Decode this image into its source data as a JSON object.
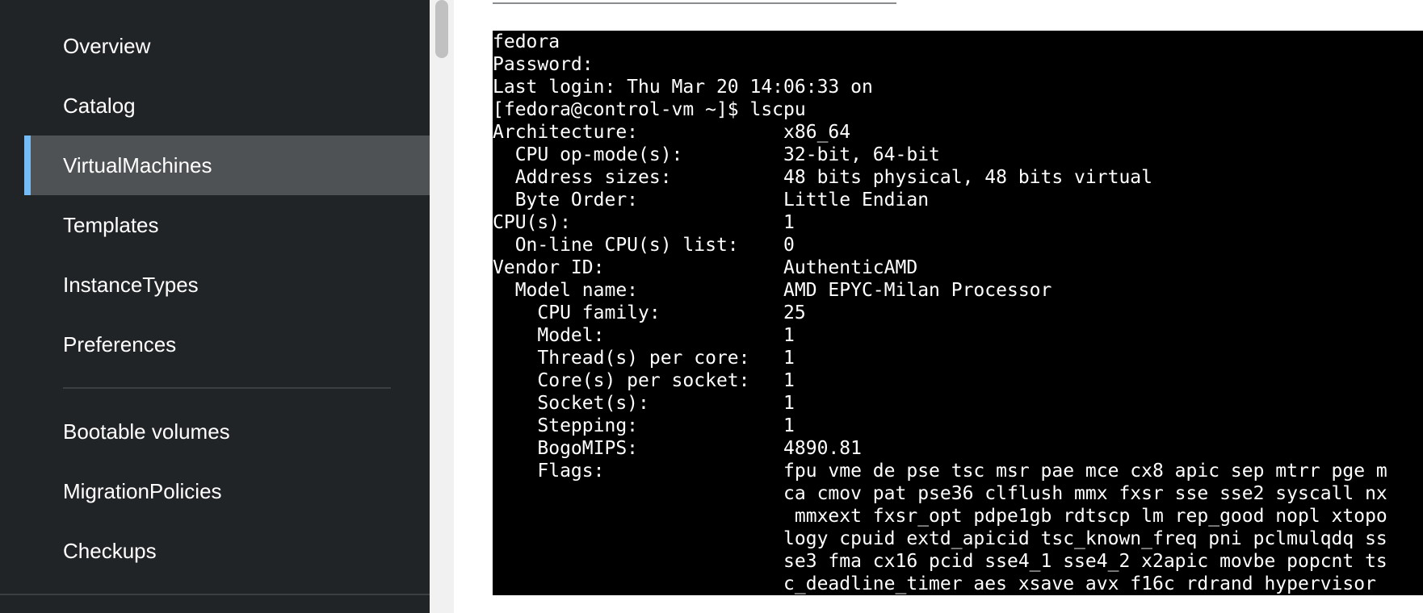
{
  "sidebar": {
    "items": [
      {
        "label": "Overview"
      },
      {
        "label": "Catalog"
      },
      {
        "label": "VirtualMachines",
        "active": true
      },
      {
        "label": "Templates"
      },
      {
        "label": "InstanceTypes"
      },
      {
        "label": "Preferences"
      },
      {
        "label": "Bootable volumes"
      },
      {
        "label": "MigrationPolicies"
      },
      {
        "label": "Checkups"
      }
    ]
  },
  "terminal": {
    "lines": [
      "fedora",
      "Password:",
      "Last login: Thu Mar 20 14:06:33 on",
      "[fedora@control-vm ~]$ lscpu",
      "Architecture:             x86_64",
      "  CPU op-mode(s):         32-bit, 64-bit",
      "  Address sizes:          48 bits physical, 48 bits virtual",
      "  Byte Order:             Little Endian",
      "CPU(s):                   1",
      "  On-line CPU(s) list:    0",
      "Vendor ID:                AuthenticAMD",
      "  Model name:             AMD EPYC-Milan Processor",
      "    CPU family:           25",
      "    Model:                1",
      "    Thread(s) per core:   1",
      "    Core(s) per socket:   1",
      "    Socket(s):            1",
      "    Stepping:             1",
      "    BogoMIPS:             4890.81",
      "    Flags:                fpu vme de pse tsc msr pae mce cx8 apic sep mtrr pge m",
      "                          ca cmov pat pse36 clflush mmx fxsr sse sse2 syscall nx",
      "                           mmxext fxsr_opt pdpe1gb rdtscp lm rep_good nopl xtopo",
      "                          logy cpuid extd_apicid tsc_known_freq pni pclmulqdq ss",
      "                          se3 fma cx16 pcid sse4_1 sse4_2 x2apic movbe popcnt ts",
      "                          c_deadline_timer aes xsave avx f16c rdrand hypervisor"
    ]
  },
  "colors": {
    "sidebar_bg": "#212427",
    "active_bg": "#4f5255",
    "active_accent": "#73bcf7",
    "terminal_bg": "#000000",
    "terminal_fg": "#ffffff"
  }
}
